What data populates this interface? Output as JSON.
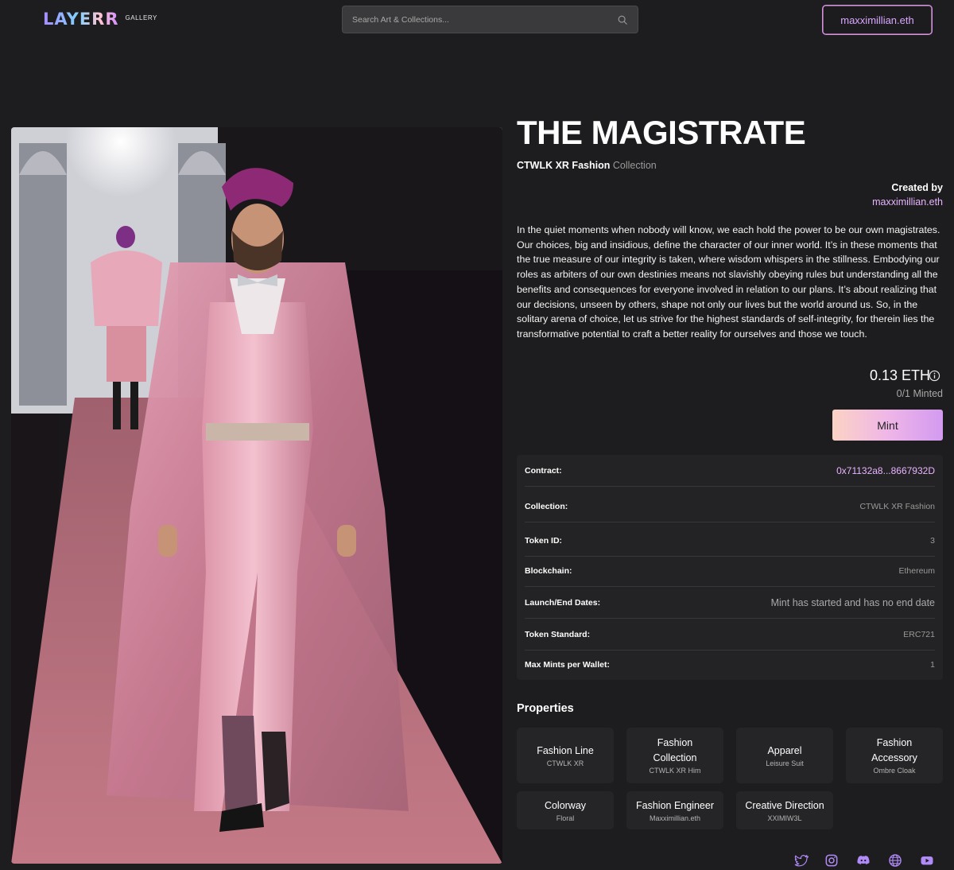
{
  "header": {
    "logo_text": "LAYERR",
    "logo_sub": "GALLERY",
    "search_placeholder": "Search Art & Collections...",
    "wallet_label": "maxximillian.eth"
  },
  "artwork": {
    "title": "THE MAGISTRATE",
    "collection_name": "CTWLK XR Fashion",
    "collection_suffix": "Collection",
    "created_by_label": "Created by",
    "creator": "maxximillian.eth",
    "description": "In the quiet moments when nobody will know, we each hold the power to be our own magistrates. Our choices, big and insidious, define the character of our inner world. It’s in these moments that the true measure of our integrity is taken, where wisdom whispers in the stillness. Embodying our roles as arbiters of our own destinies means not slavishly obeying rules but understanding all the benefits and consequences for everyone involved in relation to our plans. It’s about realizing that our decisions, unseen by others, shape not only our lives but the world around us. So, in the solitary arena of choice, let us strive for the highest standards of self-integrity, for therein lies the transformative potential to craft a better reality for ourselves and those we touch.",
    "price": "0.13 ETH",
    "minted": "0/1 Minted",
    "mint_label": "Mint"
  },
  "details": [
    {
      "label": "Contract:",
      "value": "0x71132a8...8667932D"
    },
    {
      "label": "Collection:",
      "value": "CTWLK XR Fashion"
    },
    {
      "label": "Token ID:",
      "value": "3"
    },
    {
      "label": "Blockchain:",
      "value": "Ethereum"
    },
    {
      "label": "Launch/End Dates:",
      "value": "Mint has started and has no end date"
    },
    {
      "label": "Token Standard:",
      "value": "ERC721"
    },
    {
      "label": "Max Mints per Wallet:",
      "value": "1"
    }
  ],
  "properties": {
    "title": "Properties",
    "items": [
      {
        "name": "Fashion Line",
        "value": "CTWLK XR"
      },
      {
        "name": "Fashion Collection",
        "value": "CTWLK XR Him"
      },
      {
        "name": "Apparel",
        "value": "Leisure Suit"
      },
      {
        "name": "Fashion Accessory",
        "value": "Ombre Cloak"
      },
      {
        "name": "Colorway",
        "value": "Floral"
      },
      {
        "name": "Fashion Engineer",
        "value": "Maxximillian.eth"
      },
      {
        "name": "Creative Direction",
        "value": "XXIMIW3L"
      }
    ]
  },
  "social_icons": [
    "twitter-icon",
    "instagram-icon",
    "discord-icon",
    "globe-icon",
    "youtube-icon"
  ],
  "colors": {
    "background": "#1d1d1f",
    "accent": "#e9b4ff",
    "mint_gradient_start": "#fbd3c4",
    "mint_gradient_end": "#d39af0"
  }
}
